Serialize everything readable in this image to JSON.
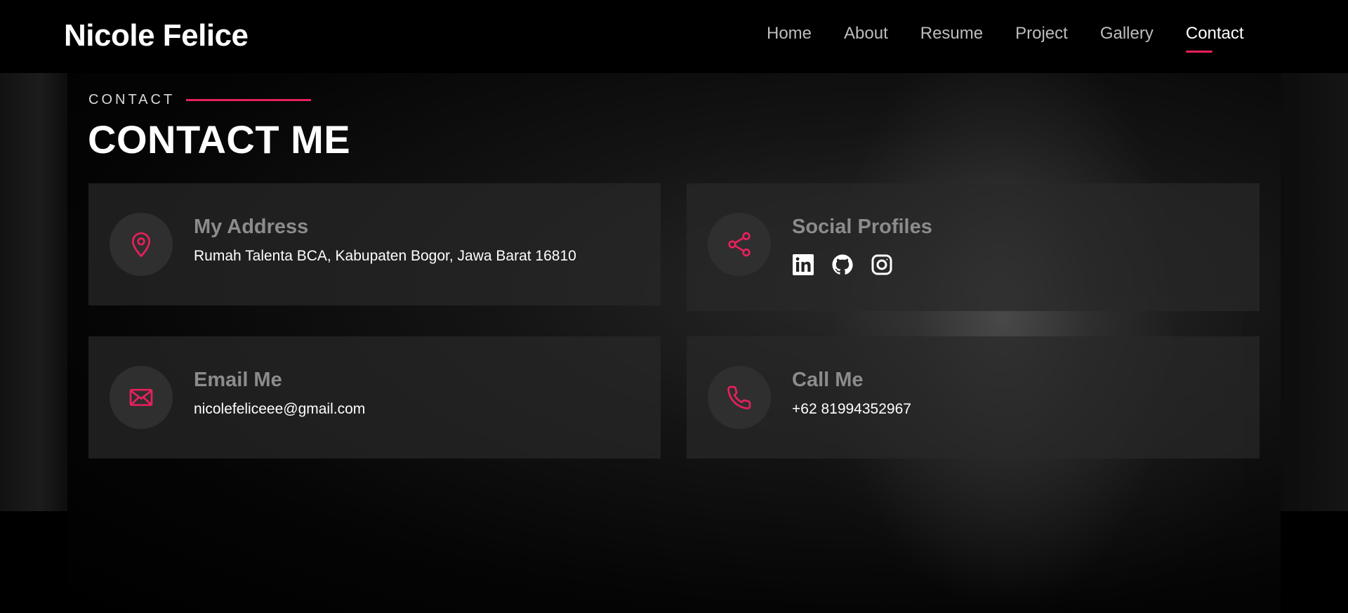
{
  "header": {
    "logo": "Nicole Felice",
    "nav": [
      "Home",
      "About",
      "Resume",
      "Project",
      "Gallery",
      "Contact"
    ],
    "active_nav": "Contact"
  },
  "section": {
    "eyebrow": "CONTACT",
    "title": "CONTACT ME"
  },
  "cards": {
    "address": {
      "icon": "map-pin-icon",
      "title": "My Address",
      "text": "Rumah Talenta BCA, Kabupaten Bogor, Jawa Barat 16810"
    },
    "social": {
      "icon": "share-icon",
      "title": "Social Profiles",
      "links": [
        "linkedin-icon",
        "github-icon",
        "instagram-icon"
      ]
    },
    "email": {
      "icon": "envelope-icon",
      "title": "Email Me",
      "text": "nicolefeliceee@gmail.com"
    },
    "phone": {
      "icon": "phone-icon",
      "title": "Call Me",
      "text": "+62 81994352967"
    }
  },
  "colors": {
    "accent": "#e8205c",
    "background": "#000000",
    "card": "#282828"
  }
}
